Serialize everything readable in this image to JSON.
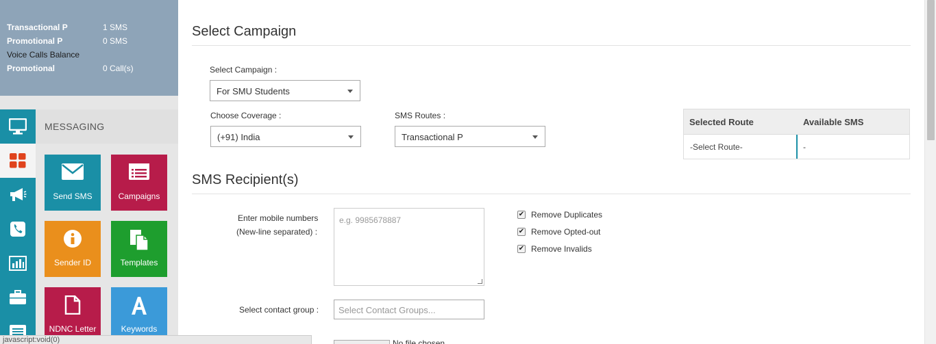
{
  "balance": {
    "rows": [
      {
        "label": "Transactional P",
        "value": "1 SMS",
        "bold": true
      },
      {
        "label": "Promotional P",
        "value": "0 SMS",
        "bold": true
      },
      {
        "label": "Voice Calls Balance",
        "value": "",
        "bold": false
      },
      {
        "label": "Promotional",
        "value": "0 Call(s)",
        "bold": true
      }
    ]
  },
  "sidebar": {
    "section_title": "MESSAGING",
    "rail_icons": [
      "monitor-icon",
      "grid-icon",
      "megaphone-icon",
      "phone-icon",
      "bar-chart-icon",
      "briefcase-icon",
      "list-icon"
    ],
    "tiles": [
      {
        "label": "Send SMS",
        "icon": "envelope-icon",
        "color": "#1a8fa6"
      },
      {
        "label": "Campaigns",
        "icon": "list-window-icon",
        "color": "#b71c4a"
      },
      {
        "label": "Sender ID",
        "icon": "info-icon",
        "color": "#ea8f1c"
      },
      {
        "label": "Templates",
        "icon": "documents-icon",
        "color": "#1e9e2e"
      },
      {
        "label": "NDNC Letter",
        "icon": "document-icon",
        "color": "#b71c4a"
      },
      {
        "label": "Keywords",
        "icon": "letter-a-icon",
        "color": "#3b9ad9"
      }
    ]
  },
  "campaign": {
    "heading": "Select Campaign",
    "select_label": "Select Campaign :",
    "select_value": "For SMU Students",
    "coverage_label": "Choose Coverage :",
    "coverage_value": "(+91) India",
    "routes_label": "SMS Routes :",
    "routes_value": "Transactional P"
  },
  "route_table": {
    "headers": [
      "Selected Route",
      "Available SMS"
    ],
    "row": [
      "-Select Route-",
      "-"
    ]
  },
  "recipients": {
    "heading": "SMS Recipient(s)",
    "numbers_label_line1": "Enter mobile numbers",
    "numbers_label_line2": "(New-line separated) :",
    "numbers_placeholder": "e.g. 9985678887",
    "options": [
      {
        "label": "Remove Duplicates",
        "checked": true
      },
      {
        "label": "Remove Opted-out",
        "checked": true
      },
      {
        "label": "Remove Invalids",
        "checked": true
      }
    ],
    "group_label": "Select contact group :",
    "group_placeholder": "Select Contact Groups...",
    "file_text": "No file chosen"
  },
  "status_bar": "javascript:void(0)",
  "colors": {
    "balance_bg": "#8ea4b8",
    "rail_bg": "#1a8fa6",
    "active_icon": "#e0431c"
  }
}
